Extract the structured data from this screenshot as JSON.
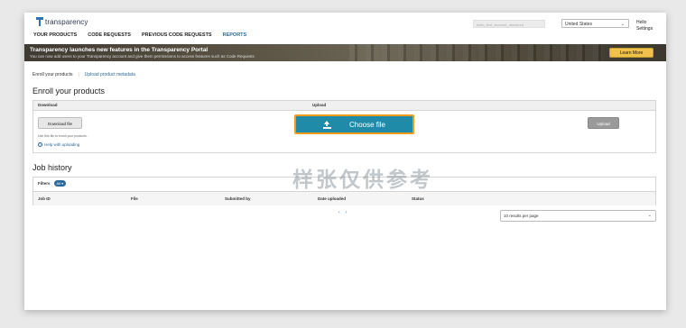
{
  "header": {
    "logo_text": "transparency",
    "nav": [
      "YOUR PRODUCTS",
      "CODE REQUESTS",
      "PREVIOUS CODE REQUESTS",
      "REPORTS"
    ],
    "active_nav": "REPORTS",
    "account_placeholder": "hello_test_account_obscured",
    "country": "United States",
    "greeting_line1": "Hello",
    "greeting_line2": "Settings"
  },
  "banner": {
    "title": "Transparency launches new features in the Transparency Portal",
    "subtitle": "You can now add users to your Transparency account and give them permissions to access features such as Code Requests",
    "button": "Learn More"
  },
  "breadcrumb": {
    "current": "Enroll your products",
    "link": "Upload product metadata"
  },
  "enroll": {
    "title": "Enroll your products",
    "col_download": "Download",
    "col_upload": "Upload",
    "download_button": "Download file",
    "hint": "Use this file to enroll your products.",
    "help_link": "Help with uploading",
    "choose_button": "Choose file",
    "upload_button": "Upload"
  },
  "jobs": {
    "title": "Job history",
    "filters_label": "Filters",
    "filter_badge": "All ▾",
    "columns": [
      "Job ID",
      "File",
      "Submitted by",
      "Date uploaded",
      "Status"
    ],
    "pager_prev": "‹",
    "pager_next": "›",
    "per_page": "10 results per page"
  },
  "watermark": "样张仅供参考",
  "colors": {
    "accent": "#2c6a9c",
    "choose_button_bg": "#1f8ba8",
    "choose_button_border": "#f29c1b",
    "learn_more_bg": "#f0c14b"
  }
}
